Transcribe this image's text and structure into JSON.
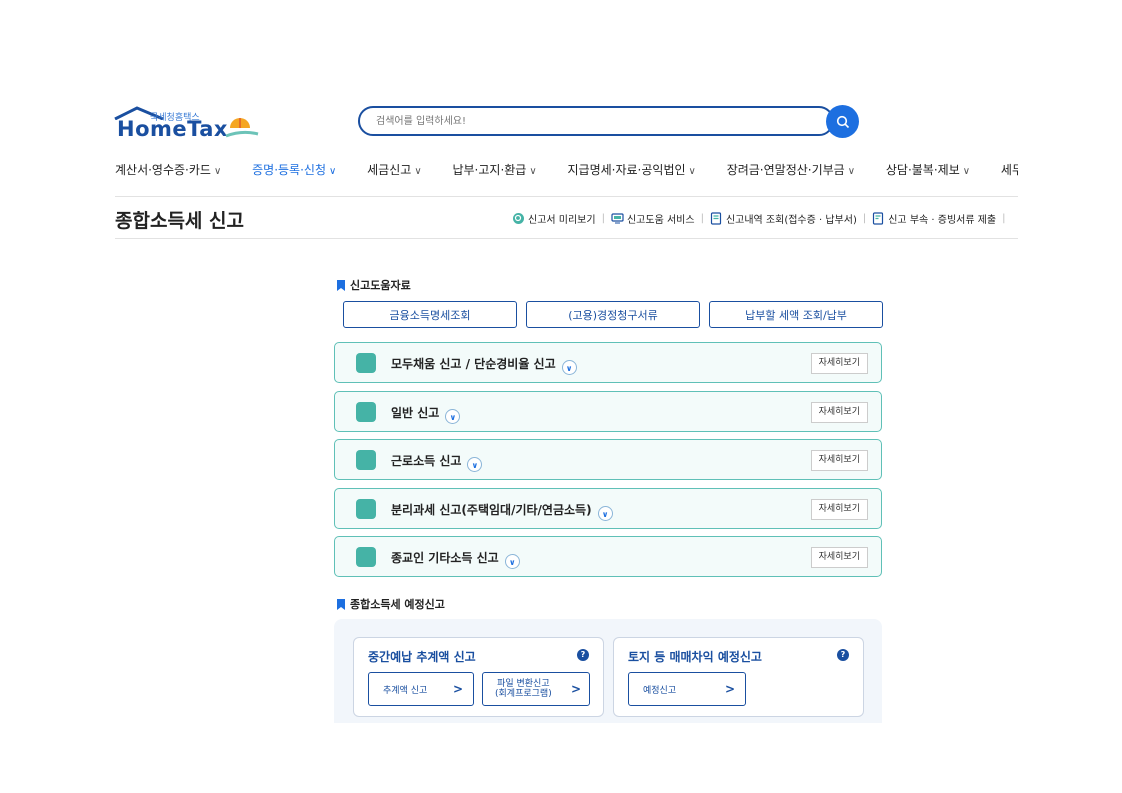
{
  "header": {
    "logo_small": "국세청홈택스",
    "logo_main": "HomeTax",
    "search_placeholder": "검색어를 입력하세요!"
  },
  "nav": [
    {
      "label": "계산서·영수증·카드",
      "active": false
    },
    {
      "label": "증명·등록·신청",
      "active": true
    },
    {
      "label": "세금신고",
      "active": false
    },
    {
      "label": "납부·고지·환급",
      "active": false
    },
    {
      "label": "지급명세·자료·공익법인",
      "active": false
    },
    {
      "label": "장려금·연말정산·기부금",
      "active": false
    },
    {
      "label": "상담·불복·제보",
      "active": false
    },
    {
      "label": "세무",
      "active": false
    }
  ],
  "page": {
    "title": "종합소득세 신고",
    "quick_links": [
      "신고서 미리보기",
      "신고도움 서비스",
      "신고내역 조회(접수증 · 납부서)",
      "신고 부속 · 증빙서류 제출"
    ]
  },
  "help_section": {
    "title": "신고도움자료",
    "buttons": [
      "금융소득명세조회",
      "(고용)경정청구서류",
      "납부할 세액 조회/납부"
    ]
  },
  "filing_types": {
    "detail_label": "자세히보기",
    "items": [
      "모두채움 신고 / 단순경비율 신고",
      "일반 신고",
      "근로소득 신고",
      "분리과세 신고(주택임대/기타/연금소득)",
      "종교인 기타소득 신고"
    ]
  },
  "estimated_section": {
    "title": "종합소득세 예정신고",
    "cards": [
      {
        "title": "중간예납 추계액 신고",
        "buttons": [
          "추계액 신고",
          "파일 변환신고\n(회계프로그램)"
        ]
      },
      {
        "title": "토지 등 매매차익 예정신고",
        "buttons": [
          "예정신고"
        ]
      }
    ],
    "help_glyph": "?"
  },
  "colors": {
    "brand": "#1a4fa0",
    "accent": "#1d6fe0",
    "teal": "#45b3a6"
  }
}
